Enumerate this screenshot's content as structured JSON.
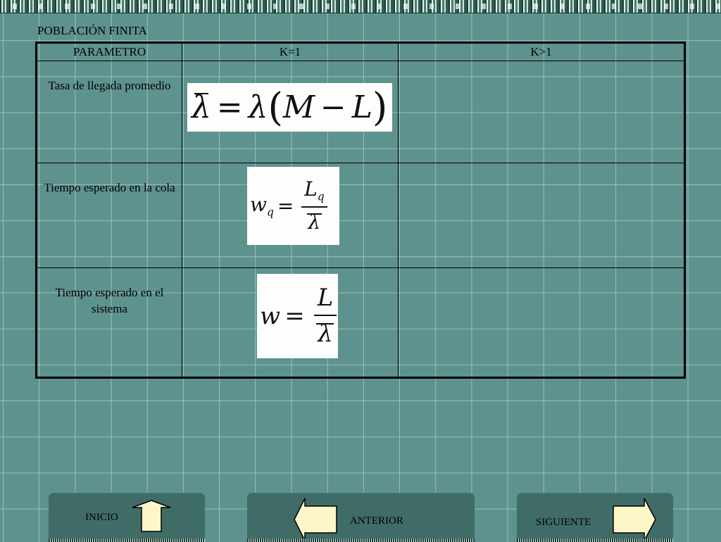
{
  "slide": {
    "title": "POBLACIÓN FINITA"
  },
  "table": {
    "headers": [
      "PARAMETRO",
      "K=1",
      "K>1"
    ],
    "rows": [
      {
        "label": "Tasa de llegada promedio",
        "formula_k1": {
          "lhs": "λ",
          "lhs_bar": true,
          "eq": "=",
          "rhs_a": "λ",
          "open": "(",
          "m": "M",
          "minus": "−",
          "l": "L",
          "close": ")"
        },
        "formula_kgt1": ""
      },
      {
        "label": "Tiempo esperado en la cola",
        "formula_k1": {
          "lhs": "w",
          "lhs_sub": "q",
          "eq": "=",
          "num": "L",
          "num_sub": "q",
          "den": "λ",
          "den_bar": true
        },
        "formula_kgt1": ""
      },
      {
        "label": "Tiempo esperado en el sistema",
        "formula_k1": {
          "lhs": "w",
          "eq": "=",
          "num": "L",
          "den": "λ",
          "den_bar": true
        },
        "formula_kgt1": ""
      }
    ]
  },
  "nav": {
    "inicio": {
      "label": "INICIO",
      "icon": "arrow-up-icon"
    },
    "anterior": {
      "label": "ANTERIOR",
      "icon": "arrow-left-icon"
    },
    "siguiente": {
      "label": "SIGUIENTE",
      "icon": "arrow-right-icon"
    }
  },
  "colors": {
    "background": "#5e928e",
    "grid_line": "#c8e6e2",
    "button_bg": "#3f6c67",
    "arrow_fill": "#fdf6c8",
    "table_border": "#000000"
  }
}
